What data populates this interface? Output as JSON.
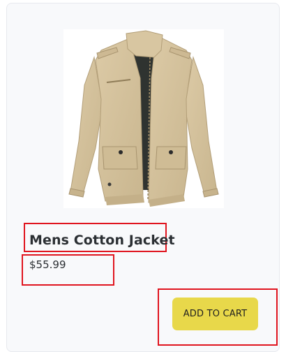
{
  "product": {
    "title": "Mens Cotton Jacket",
    "price": "$55.99",
    "image_icon": "khaki-cotton-jacket-image"
  },
  "actions": {
    "add_to_cart_label": "ADD TO CART"
  },
  "colors": {
    "accent_button": "#e8d84a",
    "highlight_border": "#e0141e",
    "jacket": "#d5c39e",
    "lining": "#2f3330"
  }
}
